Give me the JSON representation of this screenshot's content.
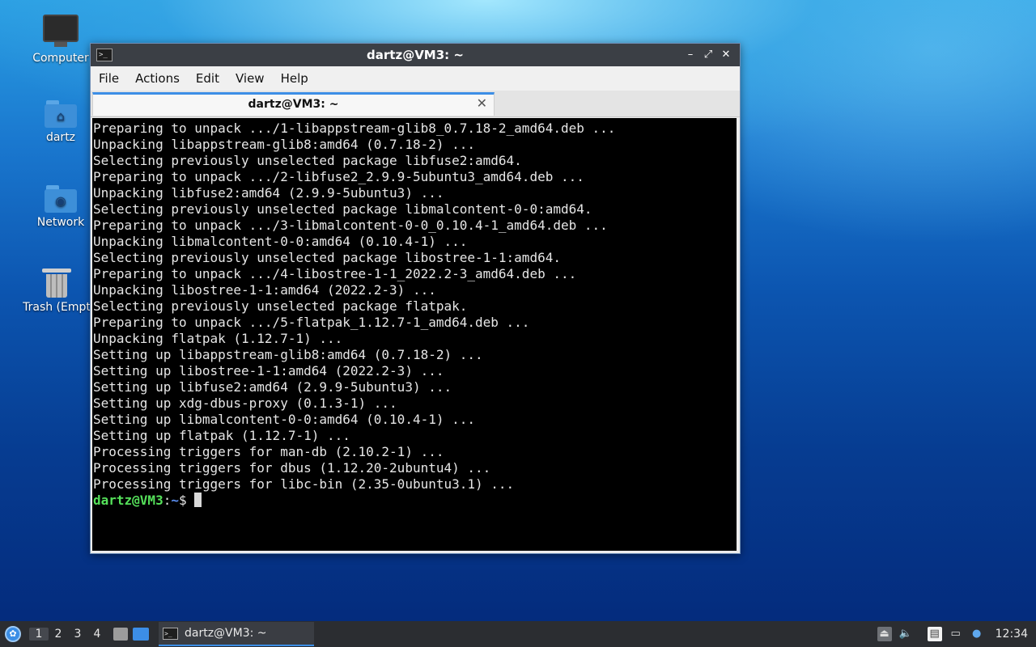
{
  "desktop": {
    "icons": [
      {
        "label": "Computer"
      },
      {
        "label": "dartz"
      },
      {
        "label": "Network"
      },
      {
        "label": "Trash (Empt"
      }
    ]
  },
  "window": {
    "title": "dartz@VM3: ~",
    "controls": {
      "minimize": "–",
      "maximize": "⤢",
      "close": "✕"
    },
    "menu": [
      "File",
      "Actions",
      "Edit",
      "View",
      "Help"
    ],
    "tab": {
      "title": "dartz@VM3: ~",
      "close": "✕"
    }
  },
  "terminal": {
    "lines": [
      "Preparing to unpack .../1-libappstream-glib8_0.7.18-2_amd64.deb ...",
      "Unpacking libappstream-glib8:amd64 (0.7.18-2) ...",
      "Selecting previously unselected package libfuse2:amd64.",
      "Preparing to unpack .../2-libfuse2_2.9.9-5ubuntu3_amd64.deb ...",
      "Unpacking libfuse2:amd64 (2.9.9-5ubuntu3) ...",
      "Selecting previously unselected package libmalcontent-0-0:amd64.",
      "Preparing to unpack .../3-libmalcontent-0-0_0.10.4-1_amd64.deb ...",
      "Unpacking libmalcontent-0-0:amd64 (0.10.4-1) ...",
      "Selecting previously unselected package libostree-1-1:amd64.",
      "Preparing to unpack .../4-libostree-1-1_2022.2-3_amd64.deb ...",
      "Unpacking libostree-1-1:amd64 (2022.2-3) ...",
      "Selecting previously unselected package flatpak.",
      "Preparing to unpack .../5-flatpak_1.12.7-1_amd64.deb ...",
      "Unpacking flatpak (1.12.7-1) ...",
      "Setting up libappstream-glib8:amd64 (0.7.18-2) ...",
      "Setting up libostree-1-1:amd64 (2022.2-3) ...",
      "Setting up libfuse2:amd64 (2.9.9-5ubuntu3) ...",
      "Setting up xdg-dbus-proxy (0.1.3-1) ...",
      "Setting up libmalcontent-0-0:amd64 (0.10.4-1) ...",
      "Setting up flatpak (1.12.7-1) ...",
      "Processing triggers for man-db (2.10.2-1) ...",
      "Processing triggers for dbus (1.12.20-2ubuntu4) ...",
      "Processing triggers for libc-bin (2.35-0ubuntu3.1) ..."
    ],
    "prompt": {
      "user_host": "dartz@VM3",
      "colon": ":",
      "path": "~",
      "symbol": "$ "
    }
  },
  "taskbar": {
    "workspaces": [
      "1",
      "2",
      "3",
      "4"
    ],
    "active_workspace": "1",
    "task": {
      "label": "dartz@VM3: ~"
    },
    "clock": "12:34"
  }
}
